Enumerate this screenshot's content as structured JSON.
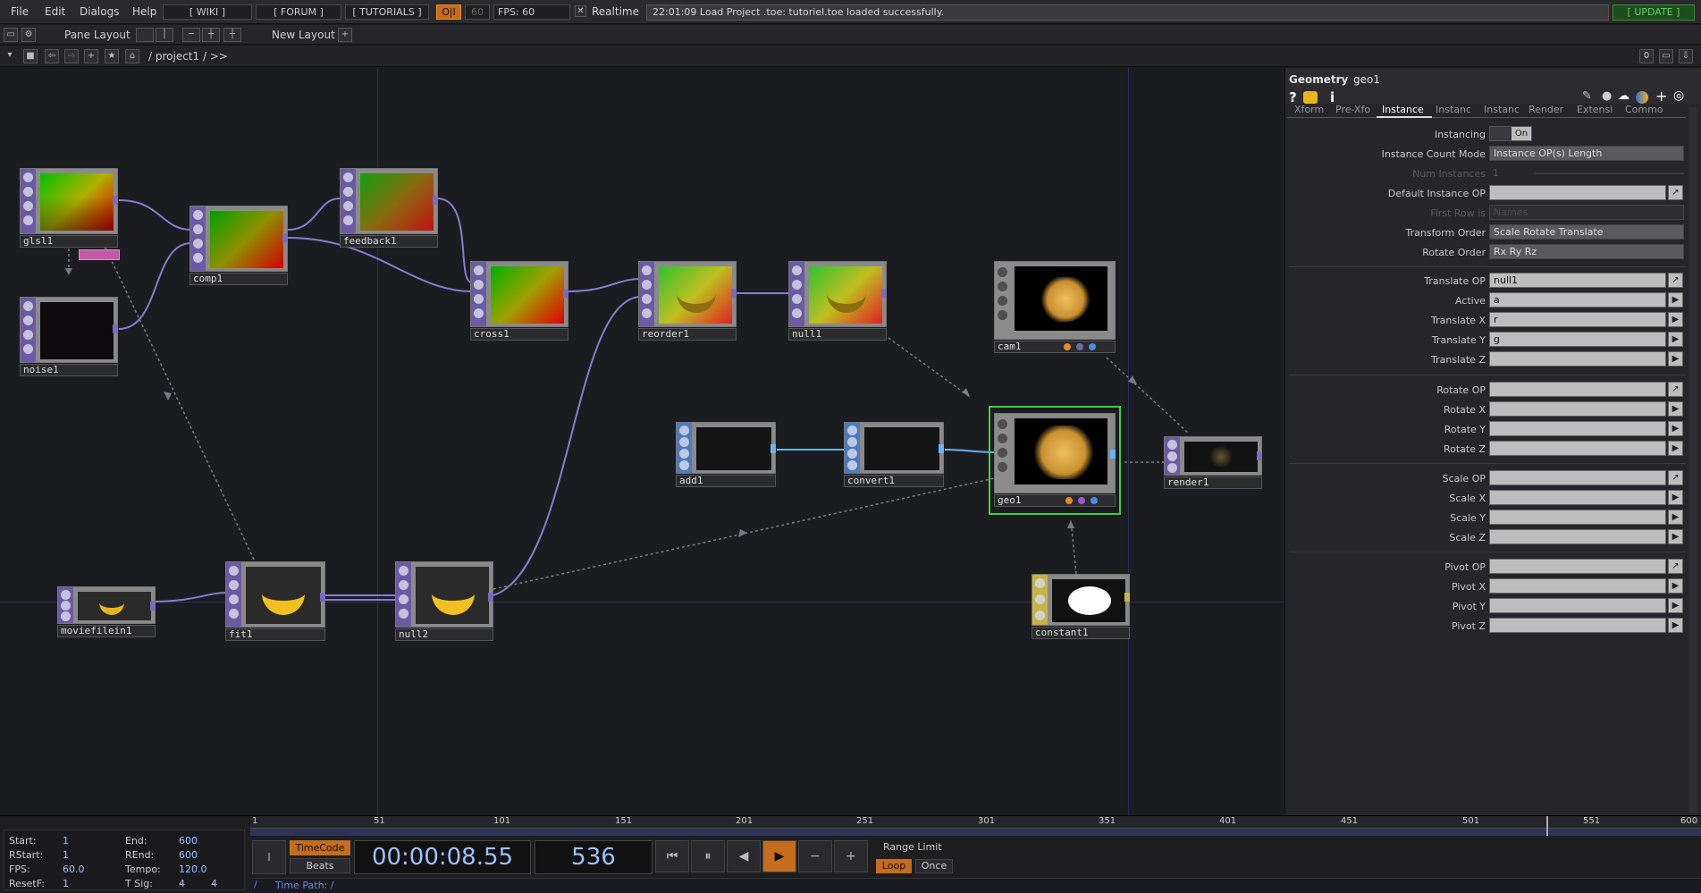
{
  "menu": {
    "items": [
      "File",
      "Edit",
      "Dialogs",
      "Help"
    ],
    "wiki": "[ WIKI ]",
    "forum": "[ FORUM ]",
    "tutorials": "[ TUTORIALS ]",
    "oi": "O|I",
    "fps_cap": "60",
    "fps_text": "FPS:  60",
    "realtime": "Realtime",
    "status": "22:01:09 Load Project .toe: tutoriel.toe loaded successfully.",
    "update": "[ UPDATE ]"
  },
  "layoutbar": {
    "pane_layout": "Pane Layout",
    "new_layout": "New Layout"
  },
  "pathbar": {
    "path": "/ project1 / >>",
    "zero": "0"
  },
  "nodes": [
    {
      "id": "glsl1",
      "label": "glsl1"
    },
    {
      "id": "noise1",
      "label": "noise1"
    },
    {
      "id": "comp1",
      "label": "comp1"
    },
    {
      "id": "feedback1",
      "label": "feedback1"
    },
    {
      "id": "cross1",
      "label": "cross1"
    },
    {
      "id": "reorder1",
      "label": "reorder1"
    },
    {
      "id": "null1",
      "label": "null1"
    },
    {
      "id": "cam1",
      "label": "cam1"
    },
    {
      "id": "add1",
      "label": "add1"
    },
    {
      "id": "convert1",
      "label": "convert1"
    },
    {
      "id": "geo1",
      "label": "geo1"
    },
    {
      "id": "render1",
      "label": "render1"
    },
    {
      "id": "moviefilein1",
      "label": "moviefilein1"
    },
    {
      "id": "fit1",
      "label": "fit1"
    },
    {
      "id": "null2",
      "label": "null2"
    },
    {
      "id": "constant1",
      "label": "constant1"
    }
  ],
  "panel": {
    "type": "Geometry",
    "name": "geo1",
    "tabs": [
      "Xform",
      "Pre-Xfo",
      "Instance",
      "Instanc",
      "Instanc",
      "Render",
      "Extensi",
      "Commo"
    ],
    "instancing_label": "Instancing",
    "instancing_value": "On",
    "count_mode_label": "Instance Count Mode",
    "count_mode_value": "Instance OP(s) Length",
    "num_instances_label": "Num Instances",
    "num_instances_value": "1",
    "default_op_label": "Default Instance OP",
    "first_row_label": "First Row is",
    "first_row_value": "Names",
    "transform_order_label": "Transform Order",
    "transform_order_value": "Scale Rotate Translate",
    "rotate_order_label": "Rotate Order",
    "rotate_order_value": "Rx Ry Rz",
    "translate_op_label": "Translate OP",
    "translate_op_value": "null1",
    "active_label": "Active",
    "active_value": "a",
    "tx_label": "Translate X",
    "tx_value": "r",
    "ty_label": "Translate Y",
    "ty_value": "g",
    "tz_label": "Translate Z",
    "rotate_op_label": "Rotate OP",
    "rx_label": "Rotate X",
    "ry_label": "Rotate Y",
    "rz_label": "Rotate Z",
    "scale_op_label": "Scale OP",
    "sx_label": "Scale X",
    "sy_label": "Scale Y",
    "sz_label": "Scale Z",
    "pivot_op_label": "Pivot OP",
    "px_label": "Pivot X",
    "py_label": "Pivot Y",
    "pz_label": "Pivot Z"
  },
  "timeline": {
    "ticks": [
      "1",
      "51",
      "101",
      "151",
      "201",
      "251",
      "301",
      "351",
      "401",
      "451",
      "501",
      "551",
      "600"
    ],
    "start_label": "Start:",
    "start": "1",
    "end_label": "End:",
    "end": "600",
    "rstart_label": "RStart:",
    "rstart": "1",
    "rend_label": "REnd:",
    "rend": "600",
    "fps_label": "FPS:",
    "fps": "60.0",
    "tempo_label": "Tempo:",
    "tempo": "120.0",
    "resetf_label": "ResetF:",
    "resetf": "1",
    "tsig_label": "T Sig:",
    "tsig_a": "4",
    "tsig_b": "4",
    "timecode": "TimeCode",
    "beats": "Beats",
    "time": "00:00:08.55",
    "frame": "536",
    "range_limit": "Range Limit",
    "loop": "Loop",
    "once": "Once",
    "time_path": "Time Path: /"
  },
  "colors": {
    "top": "#6b5aa3",
    "sop": "#4a7bbf",
    "chop": "#c8b445",
    "accent": "#e88a2a",
    "selected": "#3fd13f"
  }
}
